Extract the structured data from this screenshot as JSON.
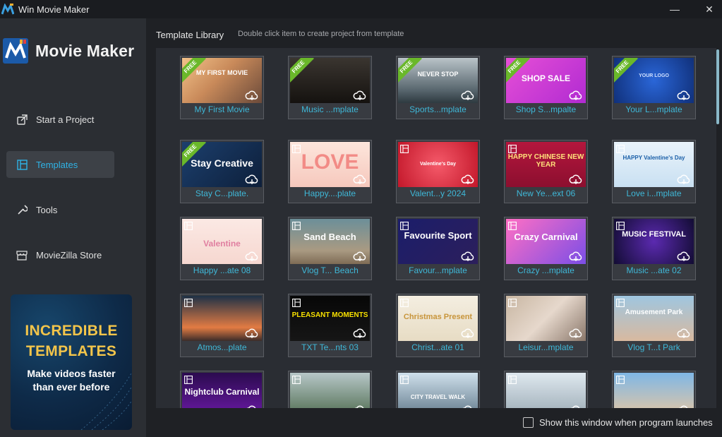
{
  "window": {
    "title": "Win Movie Maker",
    "minimize": "—",
    "close": "✕"
  },
  "logo": {
    "text": "Movie Maker"
  },
  "nav": [
    {
      "label": "Start a Project",
      "icon": "start-project-icon",
      "active": false
    },
    {
      "label": "Templates",
      "icon": "templates-icon",
      "active": true
    },
    {
      "label": "Tools",
      "icon": "tools-icon",
      "active": false
    },
    {
      "label": "MovieZilla Store",
      "icon": "store-icon",
      "active": false
    }
  ],
  "promo": {
    "headline1": "INCREDIBLE",
    "headline2": "TEMPLATES",
    "sub1": "Make videos faster",
    "sub2": "than ever before"
  },
  "library": {
    "title": "Template Library",
    "hint": "Double click item to create project from template"
  },
  "footer": {
    "show_on_launch_label": "Show this window when program launches",
    "checked": false
  },
  "colors": {
    "accent": "#2fb3e6",
    "label": "#3fb8d8",
    "free_badge": "#6ab82a",
    "sidebar": "#2b2e33",
    "active_nav": "#3d4147"
  },
  "templates": [
    {
      "label": "My First Movie",
      "free": true,
      "thumb_text": "MY FIRST MOVIE"
    },
    {
      "label": "Music ...mplate",
      "free": true,
      "thumb_text": ""
    },
    {
      "label": "Sports...mplate",
      "free": true,
      "thumb_text": "NEVER STOP"
    },
    {
      "label": "Shop S...mpalte",
      "free": true,
      "thumb_text": "SHOP SALE"
    },
    {
      "label": "Your L...mplate",
      "free": true,
      "thumb_text": "YOUR LOGO"
    },
    {
      "label": "Stay C...plate.",
      "free": true,
      "thumb_text": "Stay Creative"
    },
    {
      "label": "Happy....plate",
      "free": false,
      "thumb_text": "LOVE"
    },
    {
      "label": "Valent...y 2024",
      "free": false,
      "thumb_text": "Valentine's Day"
    },
    {
      "label": "New Ye...ext 06",
      "free": false,
      "thumb_text": "HAPPY CHINESE NEW YEAR"
    },
    {
      "label": "Love i...mplate",
      "free": false,
      "thumb_text": "HAPPY Valentine's Day"
    },
    {
      "label": "Happy ...ate 08",
      "free": false,
      "thumb_text": "Valentine"
    },
    {
      "label": "Vlog T... Beach",
      "free": false,
      "thumb_text": "Sand Beach"
    },
    {
      "label": "Favour...mplate",
      "free": false,
      "thumb_text": "Favourite Sport"
    },
    {
      "label": "Crazy ...mplate",
      "free": false,
      "thumb_text": "Crazy Carnival"
    },
    {
      "label": "Music ...ate 02",
      "free": false,
      "thumb_text": "MUSIC FESTIVAL"
    },
    {
      "label": "Atmos...plate",
      "free": false,
      "thumb_text": ""
    },
    {
      "label": "TXT Te...nts 03",
      "free": false,
      "thumb_text": "PLEASANT MOMENTS"
    },
    {
      "label": "Christ...ate 01",
      "free": false,
      "thumb_text": "Christmas Present"
    },
    {
      "label": "Leisur...mplate",
      "free": false,
      "thumb_text": ""
    },
    {
      "label": "Vlog T...t Park",
      "free": false,
      "thumb_text": "Amusement Park"
    },
    {
      "label": "",
      "free": false,
      "thumb_text": "Nightclub Carnival"
    },
    {
      "label": "",
      "free": false,
      "thumb_text": ""
    },
    {
      "label": "",
      "free": false,
      "thumb_text": "CITY TRAVEL WALK"
    },
    {
      "label": "",
      "free": false,
      "thumb_text": ""
    },
    {
      "label": "",
      "free": false,
      "thumb_text": ""
    }
  ]
}
